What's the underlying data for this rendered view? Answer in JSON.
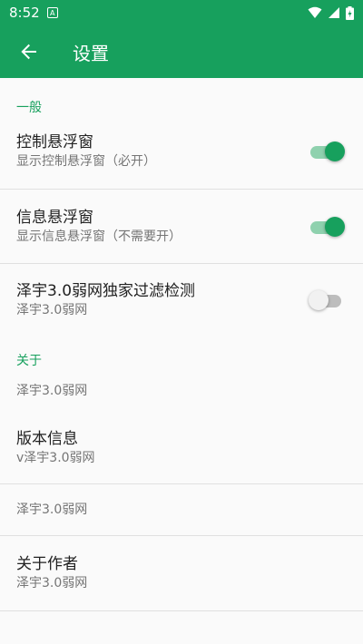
{
  "status_bar": {
    "time": "8:52",
    "notification_icon": "A"
  },
  "toolbar": {
    "title": "设置"
  },
  "sections": {
    "general": {
      "header": "一般"
    },
    "about": {
      "header": "关于"
    }
  },
  "items": {
    "floating_control": {
      "title": "控制悬浮窗",
      "summary": "显示控制悬浮窗（必开）",
      "enabled": true
    },
    "floating_info": {
      "title": "信息悬浮窗",
      "summary": "显示信息悬浮窗（不需要开）",
      "enabled": true
    },
    "filter_detect": {
      "title": "泽宇3.0弱网独家过滤检测",
      "summary": "泽宇3.0弱网",
      "enabled": false
    },
    "about_plain_1": {
      "summary": "泽宇3.0弱网"
    },
    "version": {
      "title": "版本信息",
      "summary": "v泽宇3.0弱网"
    },
    "about_plain_2": {
      "summary": "泽宇3.0弱网"
    },
    "author": {
      "title": "关于作者",
      "summary": "泽宇3.0弱网"
    }
  },
  "colors": {
    "primary": "#17a05d",
    "switch_track_on": "#8fd1ae"
  }
}
